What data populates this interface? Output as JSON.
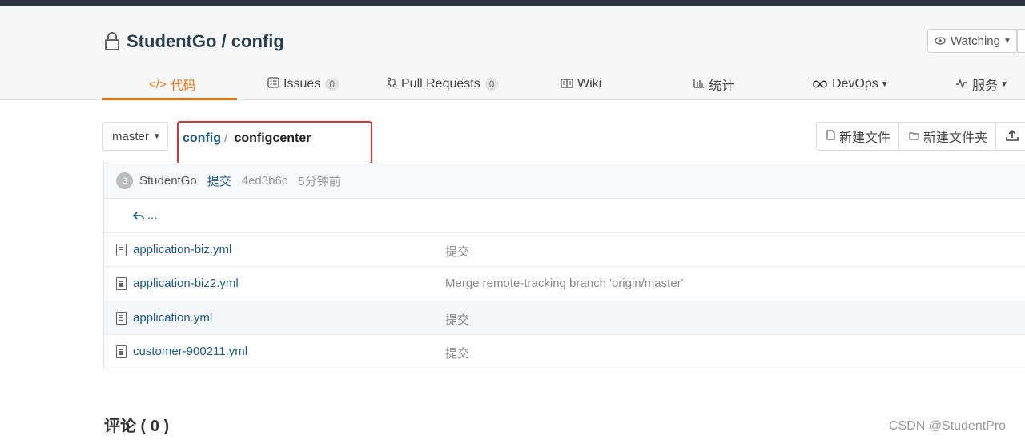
{
  "repo": {
    "title": "StudentGo / config",
    "watch_label": "Watching"
  },
  "tabs": [
    {
      "label": "代码",
      "icon": "code-icon",
      "active": true
    },
    {
      "label": "Issues",
      "icon": "issues-icon",
      "badge": "0"
    },
    {
      "label": "Pull Requests",
      "icon": "pull-request-icon",
      "badge": "0"
    },
    {
      "label": "Wiki",
      "icon": "wiki-icon"
    },
    {
      "label": "统计",
      "icon": "stats-icon"
    },
    {
      "label": "DevOps",
      "icon": "devops-icon",
      "dropdown": true
    },
    {
      "label": "服务",
      "icon": "service-icon",
      "dropdown": true
    }
  ],
  "branch": {
    "label": "master"
  },
  "breadcrumb": {
    "root": "config",
    "separator": "/",
    "current": "configcenter"
  },
  "actions": {
    "new_file": "新建文件",
    "new_folder": "新建文件夹"
  },
  "commit": {
    "avatar_letter": "S",
    "author": "StudentGo",
    "message": "提交",
    "hash": "4ed3b6c",
    "time": "5分钟前"
  },
  "parent_dir": "...",
  "files": [
    {
      "name": "application-biz.yml",
      "message": "提交"
    },
    {
      "name": "application-biz2.yml",
      "message": "Merge remote-tracking branch 'origin/master'"
    },
    {
      "name": "application.yml",
      "message": "提交",
      "highlighted": true
    },
    {
      "name": "customer-900211.yml",
      "message": "提交"
    }
  ],
  "comments": {
    "title": "评论 ( 0 )"
  },
  "watermark": "CSDN @StudentPro",
  "colors": {
    "accent": "#f0700c",
    "link": "#1d5a84",
    "annotation": "#e03030"
  }
}
